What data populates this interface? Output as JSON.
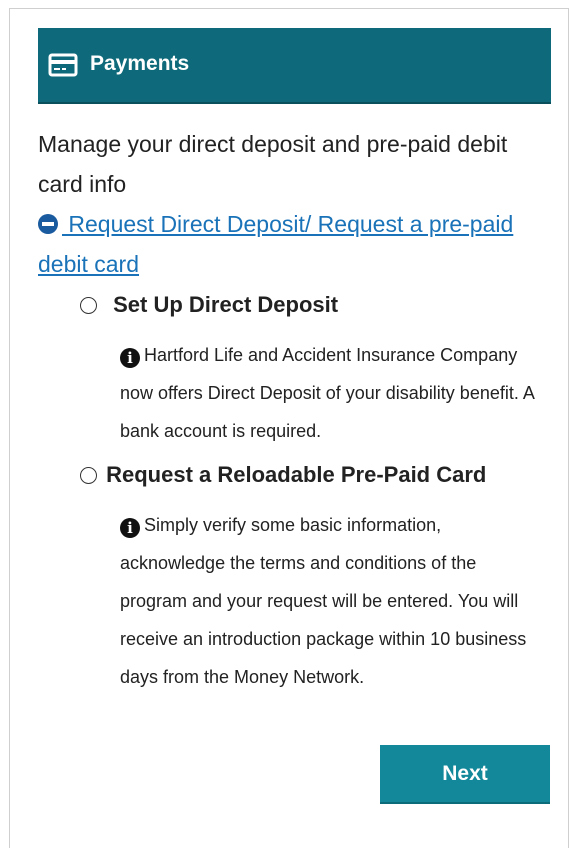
{
  "header": {
    "icon": "credit-card-icon",
    "title": "Payments"
  },
  "intro_text": "Manage your direct deposit and pre-paid debit card info",
  "toggle": {
    "icon": "minus-circle-icon",
    "link_text": " Request Direct Deposit/ Request a pre-paid debit card"
  },
  "options": [
    {
      "label": "Set Up Direct Deposit",
      "selected": false,
      "info_icon": "info-circle-icon",
      "info_text": "Hartford Life and Accident Insurance Company now offers Direct Deposit of your disability benefit. A bank account is required."
    },
    {
      "label": "Request a Reloadable Pre-Paid Card",
      "selected": false,
      "info_icon": "info-circle-icon",
      "info_text": "Simply verify some basic information, acknowledge the terms and conditions of the program and your request will be entered. You will receive an introduction package within 10 business days from the Money Network."
    }
  ],
  "next_button": {
    "label": "Next"
  },
  "colors": {
    "header_bg": "#0e6a7a",
    "link": "#1a73b8",
    "button_bg": "#12889a"
  }
}
